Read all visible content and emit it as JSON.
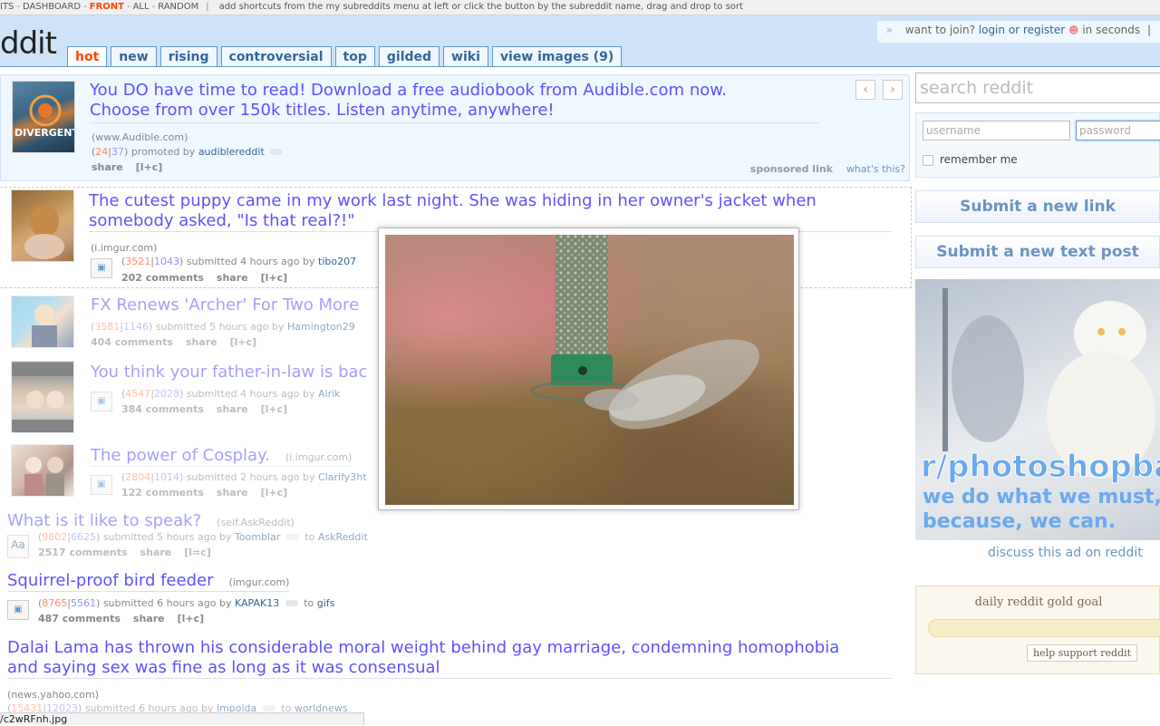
{
  "shortcut_bar": {
    "items": [
      "ITS",
      "DASHBOARD",
      "FRONT",
      "ALL",
      "RANDOM"
    ],
    "hint": "add shortcuts from the my subreddits menu at left or click the button by the subreddit name, drag and drop to sort"
  },
  "header": {
    "logo": "ddit",
    "tabs": [
      "hot",
      "new",
      "rising",
      "controversial",
      "top",
      "gilded",
      "wiki",
      "view images (9)"
    ],
    "active_tab": "hot",
    "userbox": {
      "arrows": "»",
      "prefix": "want to join?",
      "login": "login or register",
      "suffix": "in seconds",
      "bar": "|"
    }
  },
  "promoted": {
    "title_line1": "You DO have time to read! Download a free audiobook from Audible.com now.",
    "title_line2": "Choose from over 150k titles. Listen anytime, anywhere!",
    "domain": "(www.Audible.com)",
    "up": "24",
    "down": "37",
    "promoted_by": "promoted by",
    "author": "audiblereddit",
    "actions": [
      "share",
      "[l+c]"
    ],
    "sponsored": "sponsored link",
    "whats_this": "what's this?",
    "thumb_text": "DIVERGENT",
    "prev": "‹",
    "next": "›"
  },
  "posts": [
    {
      "title_line1": "The cutest puppy came in my work last night. She was hiding in her owner's jacket when",
      "title_line2": "somebody asked, \"Is that real?!\"",
      "domain": "(i.imgur.com)",
      "up": "3521",
      "down": "1043",
      "submitted": "submitted 4 hours ago by",
      "author": "tibo207",
      "comments": "202 comments",
      "share": "share",
      "lc": "[l+c]"
    },
    {
      "title": "FX Renews 'Archer' For Two More",
      "up": "3581",
      "down": "1146",
      "submitted": "submitted 5 hours ago by",
      "author": "Hamington29",
      "comments": "404 comments",
      "share": "share",
      "lc": "[l+c]"
    },
    {
      "title": "You think your father-in-law is bac",
      "up": "4547",
      "down": "2028",
      "submitted": "submitted 4 hours ago by",
      "author": "Alrik",
      "comments": "384 comments",
      "share": "share",
      "lc": "[l+c]"
    },
    {
      "title": "The power of Cosplay.",
      "domain": "(i.imgur.com)",
      "up": "2804",
      "down": "1014",
      "submitted": "submitted 2 hours ago by",
      "author": "Clarify3ht",
      "comments": "122 comments",
      "share": "share",
      "lc": "[l+c]"
    },
    {
      "title": "What is it like to speak?",
      "domain": "(self.AskReddit)",
      "up": "9802",
      "down": "6625",
      "submitted": "submitted 5 hours ago by",
      "author": "Toomblar",
      "to": "to",
      "subreddit": "AskReddit",
      "comments": "2517 comments",
      "share": "share",
      "lc": "[l=c]"
    },
    {
      "title": "Squirrel-proof bird feeder",
      "domain": "(imgur.com)",
      "up": "8765",
      "down": "5561",
      "submitted": "submitted 6 hours ago by",
      "author": "KAPAK13",
      "to": "to",
      "subreddit": "gifs",
      "comments": "487 comments",
      "share": "share",
      "lc": "[l+c]"
    },
    {
      "title_line1": "Dalai Lama has thrown his considerable moral weight behind gay marriage, condemning homophobia",
      "title_line2": "and saying sex was fine as long as it was consensual",
      "domain": "(news.yahoo.com)",
      "up": "15431",
      "down": "12023",
      "submitted": "submitted 6 hours ago by",
      "author": "impoida",
      "to": "to",
      "subreddit": "worldnews"
    }
  ],
  "sidebar": {
    "search_placeholder": "search reddit",
    "username_placeholder": "username",
    "password_placeholder": "password",
    "remember_me": "remember me",
    "submit_link": "Submit a new link",
    "submit_text": "Submit a new text post",
    "ad_text_1": "r/photoshopbat",
    "ad_text_2": "we do what we must,",
    "ad_text_3": "because, we can.",
    "discuss_ad": "discuss this ad on reddit",
    "gold_title": "daily reddit gold goal",
    "gold_progress": 0.0,
    "help_support": "help support reddit"
  },
  "status_bar": {
    "url": "/c2wRFnh.jpg"
  }
}
